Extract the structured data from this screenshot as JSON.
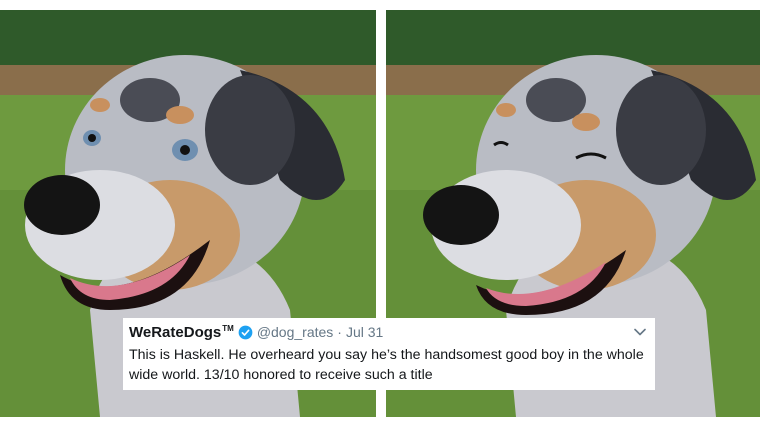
{
  "tweet": {
    "display_name": "WeRateDogs",
    "trademark": "TM",
    "handle": "@dog_rates",
    "separator": "·",
    "date": "Jul 31",
    "text": "This is Haskell. He overheard you say he’s the handsomest good boy in the whole wide world. 13/10 honored to receive such a title"
  },
  "icons": {
    "verified": "verified-badge-icon",
    "menu": "chevron-down-icon"
  },
  "colors": {
    "verified_blue": "#1da1f2",
    "secondary_text": "#657786",
    "primary_text": "#14171a"
  }
}
